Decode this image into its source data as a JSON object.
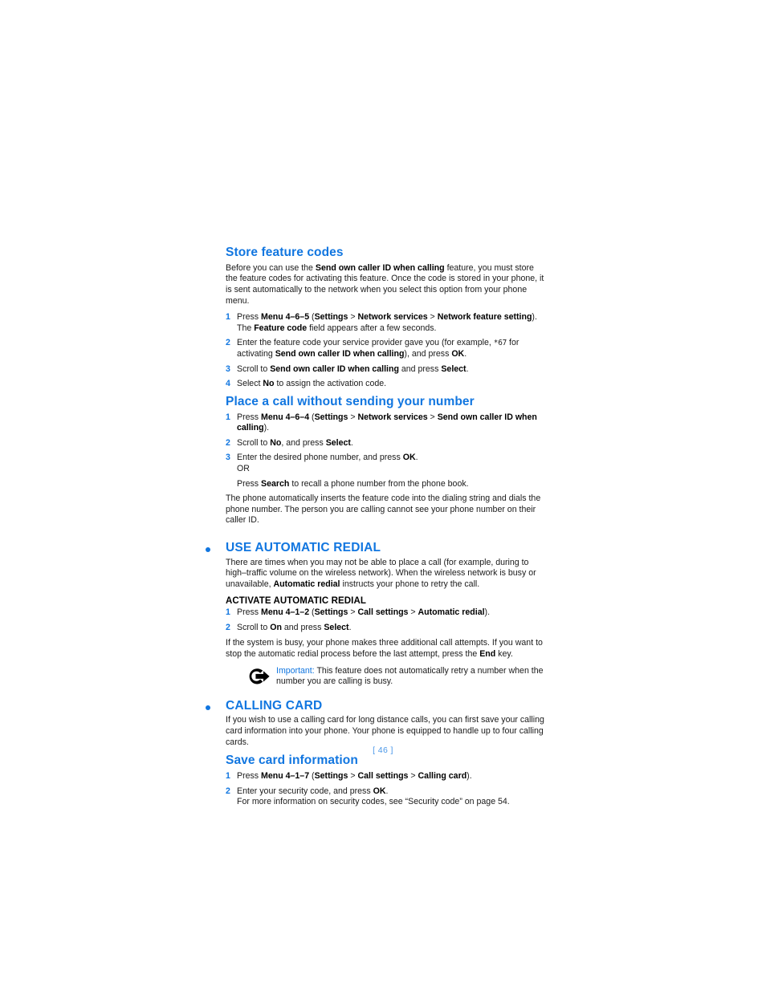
{
  "document": {
    "page_number_label": "[ 46 ]",
    "accent_color": "#1176e0",
    "footer_color": "#4a97e8",
    "text_color": "#1a1a1a"
  },
  "sections": {
    "store_feature_codes": {
      "heading": "Store feature codes",
      "intro_part1": "Before you can use the ",
      "intro_bold1": "Send own caller ID when calling",
      "intro_part2": " feature, you must store the feature codes for activating this feature. Once the code is stored in your phone, it is sent automatically to the network when you select this option from your phone menu.",
      "steps": [
        {
          "num": "1",
          "pre": "Press ",
          "bold1": "Menu 4–6–5",
          "mid1": " (",
          "bold2": "Settings",
          "sep1": " > ",
          "bold3": "Network services",
          "sep2": " > ",
          "bold4": "Network feature setting",
          "post": ")."
        },
        {
          "num": "2",
          "pre": "Enter the feature code your service provider gave you (for example, ",
          "code": "*67",
          "mid1": " for activating ",
          "bold1": "Send own caller ID when calling",
          "mid2": "), and press ",
          "bold2": "OK",
          "post": "."
        },
        {
          "num": "3",
          "pre": "Scroll to ",
          "bold1": "Send own caller ID when calling",
          "mid1": " and press ",
          "bold2": "Select",
          "post": "."
        },
        {
          "num": "4",
          "pre": "Select ",
          "bold1": "No",
          "post": " to assign the activation code."
        }
      ],
      "substep_after_step1": {
        "pre": "The ",
        "bold1": "Feature code",
        "post": " field appears after a few seconds."
      }
    },
    "place_a_call": {
      "heading": "Place a call without sending your number",
      "steps": [
        {
          "num": "1",
          "pre": "Press ",
          "bold1": "Menu 4–6–4",
          "mid1": " (",
          "bold2": "Settings",
          "sep1": " > ",
          "bold3": "Network services",
          "sep2": " > ",
          "bold4": "Send own caller ID when calling",
          "post": ")."
        },
        {
          "num": "2",
          "pre": "Scroll to ",
          "bold1": "No",
          "mid1": ", and press ",
          "bold2": "Select",
          "post": "."
        },
        {
          "num": "3",
          "pre": "Enter the desired phone number, and press ",
          "bold1": "OK",
          "post": "."
        }
      ],
      "or_label": "OR",
      "or_line": {
        "pre": "Press ",
        "bold1": "Search",
        "post": " to recall a phone number from the phone book."
      },
      "closing": "The phone automatically inserts the feature code into the dialing string and dials the phone number. The person you are calling cannot see your phone number on their caller ID."
    },
    "use_automatic_redial": {
      "heading": "USE AUTOMATIC REDIAL",
      "intro_part1": "There are times when you may not be able to place a call (for example, during to high–traffic volume on the wireless network). When the wireless network is busy or unavailable, ",
      "intro_bold1": "Automatic redial",
      "intro_part2": " instructs your phone to retry the call.",
      "subheading": "ACTIVATE AUTOMATIC REDIAL",
      "steps": [
        {
          "num": "1",
          "pre": "Press ",
          "bold1": "Menu 4–1–2",
          "mid1": " (",
          "bold2": "Settings",
          "sep1": " > ",
          "bold3": "Call settings",
          "sep2": " > ",
          "bold4": "Automatic redial",
          "post": ")."
        },
        {
          "num": "2",
          "pre": "Scroll to ",
          "bold1": "On",
          "mid1": " and press ",
          "bold2": "Select",
          "post": "."
        }
      ],
      "closing_part1": "If the system is busy, your phone makes three additional call attempts. If you want to stop the automatic redial process before the last attempt, press the ",
      "closing_bold1": "End",
      "closing_part2": " key.",
      "note": {
        "icon": "important-pointer-icon",
        "label": "Important:",
        "text": " This feature does not automatically retry a number when the number you are calling is busy."
      }
    },
    "calling_card": {
      "heading": "CALLING CARD",
      "intro": "If you wish to use a calling card for long distance calls, you can first save your calling card information into your phone. Your phone is equipped to handle up to four calling cards.",
      "sub_heading": "Save card information",
      "steps": [
        {
          "num": "1",
          "pre": "Press ",
          "bold1": "Menu 4–1–7",
          "mid1": " (",
          "bold2": "Settings",
          "sep1": " > ",
          "bold3": "Call settings",
          "sep2": " > ",
          "bold4": "Calling card",
          "post": ")."
        },
        {
          "num": "2",
          "pre": "Enter your security code, and press ",
          "bold1": "OK",
          "post": "."
        }
      ],
      "closing": "For more information on security codes, see “Security code” on page 54."
    }
  }
}
